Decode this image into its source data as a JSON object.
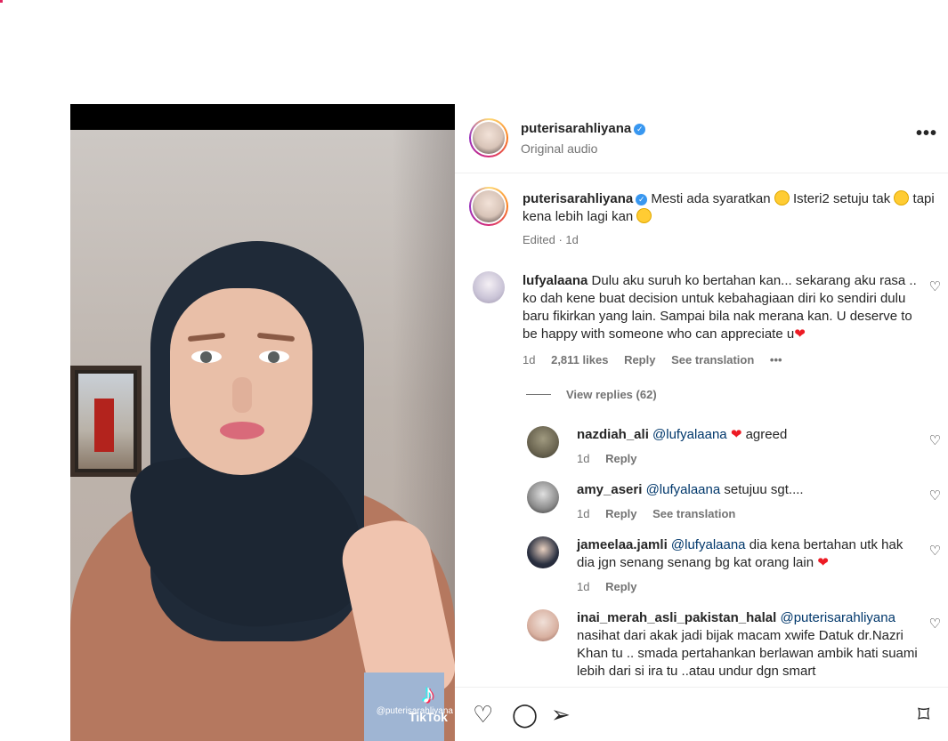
{
  "post": {
    "author": "puterisarahliyana",
    "audio": "Original audio",
    "video_brand": "TikTok",
    "video_handle": "@puterisarahliyana",
    "caption": {
      "part1": "Mesti ada syaratkan",
      "part2": "Isteri2 setuju tak",
      "part3": "tapi kena lebih lagi kan",
      "meta": "Edited · 1d"
    }
  },
  "comments": [
    {
      "user": "lufyalaana",
      "text": "Dulu aku suruh ko bertahan kan... sekarang aku rasa .. ko dah kene buat decision untuk kebahagiaan diri ko sendiri dulu baru fikirkan yang lain. Sampai bila nak merana kan. U deserve to be happy with someone who can appreciate u",
      "time": "1d",
      "likes": "2,811 likes",
      "reply": "Reply",
      "translate": "See translation",
      "more": "•••",
      "view_replies": "View replies (62)"
    }
  ],
  "replies": [
    {
      "user": "nazdiah_ali",
      "mention": "@lufyalaana",
      "text": "agreed",
      "time": "1d",
      "reply": "Reply"
    },
    {
      "user": "amy_aseri",
      "mention": "@lufyalaana",
      "text": "setujuu sgt....",
      "time": "1d",
      "reply": "Reply",
      "translate": "See translation"
    },
    {
      "user": "jameelaa.jamli",
      "mention": "@lufyalaana",
      "text": "dia kena bertahan utk hak dia jgn senang senang bg kat orang lain",
      "time": "1d",
      "reply": "Reply"
    },
    {
      "user": "inai_merah_asli_pakistan_halal",
      "mention": "@puterisarahliyana",
      "text": "nasihat dari akak jadi bijak macam xwife Datuk dr.Nazri Khan tu .. smada pertahankan berlawan ambik hati suami lebih dari si ira tu ..atau undur dgn smart"
    }
  ],
  "icons": {
    "like": "♡",
    "comment": "◯",
    "share": "➢",
    "save": "⌑",
    "more": "•••"
  }
}
